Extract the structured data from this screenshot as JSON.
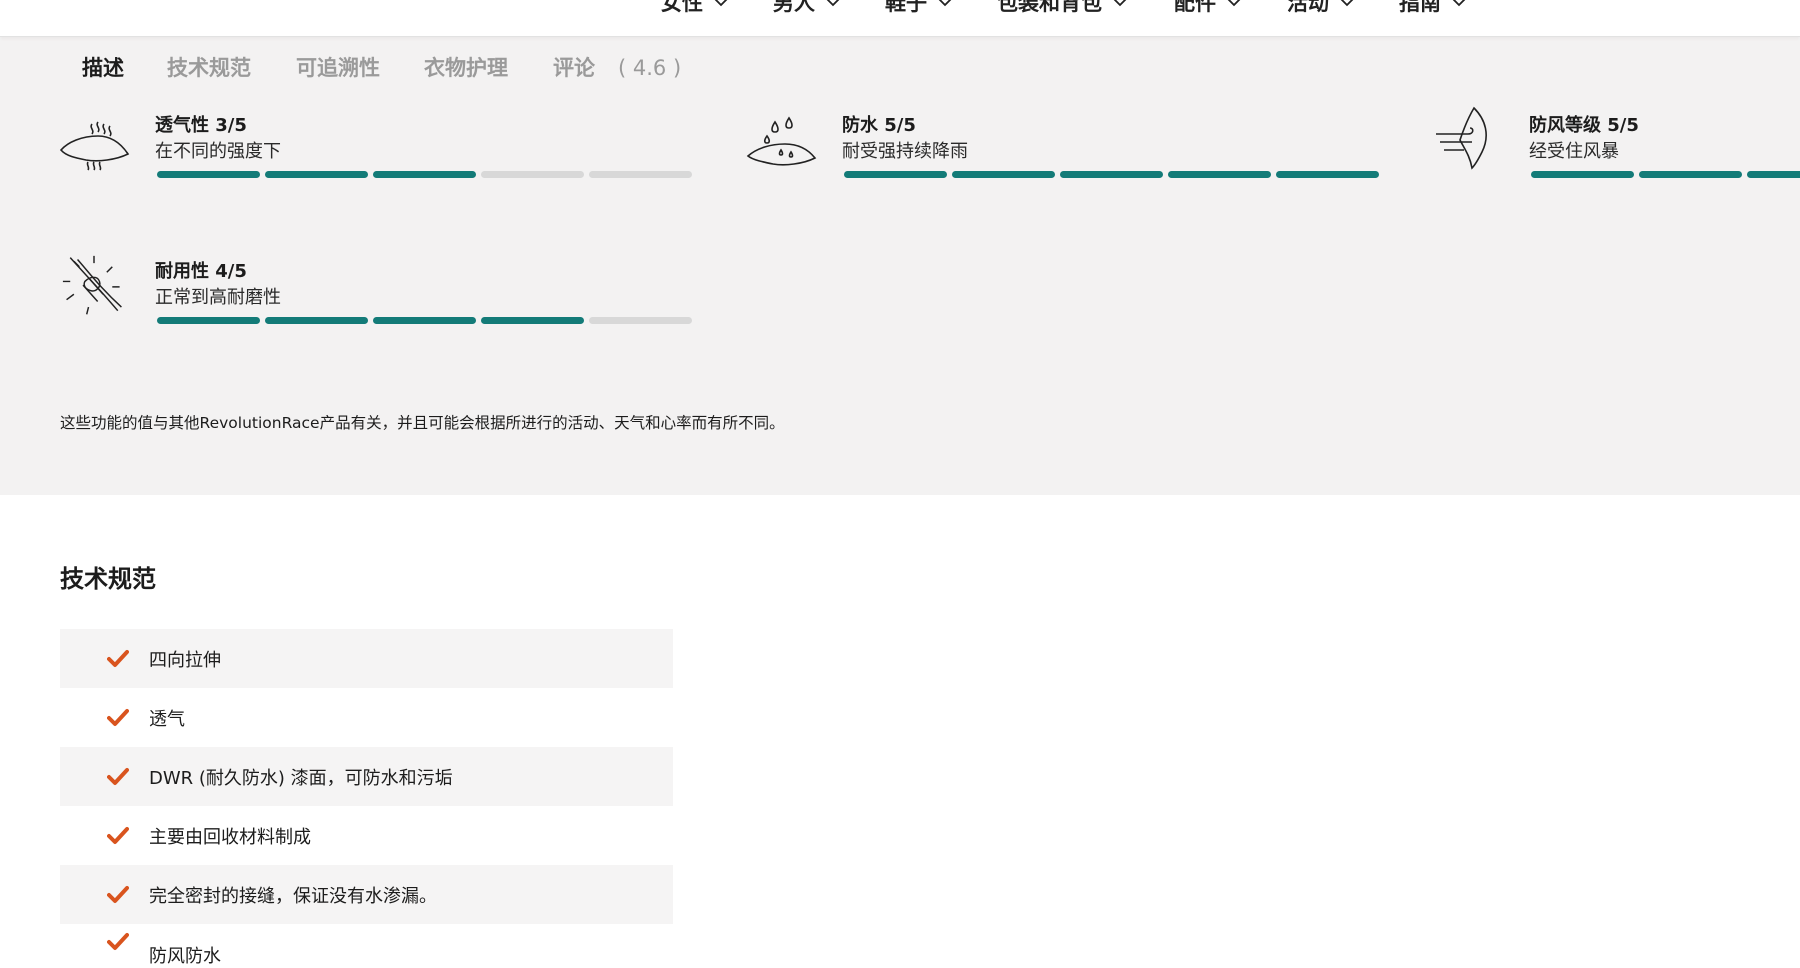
{
  "topnav": {
    "items": [
      {
        "label": "女性",
        "icon": "chevron-down-icon"
      },
      {
        "label": "男人",
        "icon": "chevron-down-icon"
      },
      {
        "label": "鞋子",
        "icon": "chevron-down-icon"
      },
      {
        "label": "包装和背包",
        "icon": "chevron-down-icon"
      },
      {
        "label": "配件",
        "icon": "chevron-down-icon"
      },
      {
        "label": "活动",
        "icon": "chevron-down-icon"
      },
      {
        "label": "指南",
        "icon": "chevron-down-icon"
      }
    ]
  },
  "tabs": {
    "items": [
      "描述",
      "技术规范",
      "可追溯性",
      "衣物护理",
      "评论"
    ],
    "active": "描述",
    "review_score": "( 4.6 )"
  },
  "ratings": [
    {
      "title": "透气性 3/5",
      "desc": "在不同的强度下",
      "value": 3,
      "max": 5,
      "icon": "breathability-icon"
    },
    {
      "title": "防水 5/5",
      "desc": "耐受强持续降雨",
      "value": 5,
      "max": 5,
      "icon": "waterproof-icon"
    },
    {
      "title": "防风等级 5/5",
      "desc": "经受住风暴",
      "value": 5,
      "max": 5,
      "icon": "windproof-icon"
    },
    {
      "title": "耐用性 4/5",
      "desc": "正常到高耐磨性",
      "value": 4,
      "max": 5,
      "icon": "durability-icon"
    }
  ],
  "ratings_note": "这些功能的值与其他RevolutionRace产品有关，并且可能会根据所进行的活动、天气和心率而有所不同。",
  "tech_specs": {
    "heading": "技术规范",
    "items": [
      "四向拉伸",
      "透气",
      "DWR (耐久防水) 漆面，可防水和污垢",
      "主要由回收材料制成",
      "完全密封的接缝，保证没有水渗漏。",
      "防风防水"
    ]
  },
  "colors": {
    "accent_teal": "#137b78",
    "bar_empty": "#d8d8d8",
    "check_orange": "#d9541e",
    "section_grey": "#f3f2f2"
  }
}
